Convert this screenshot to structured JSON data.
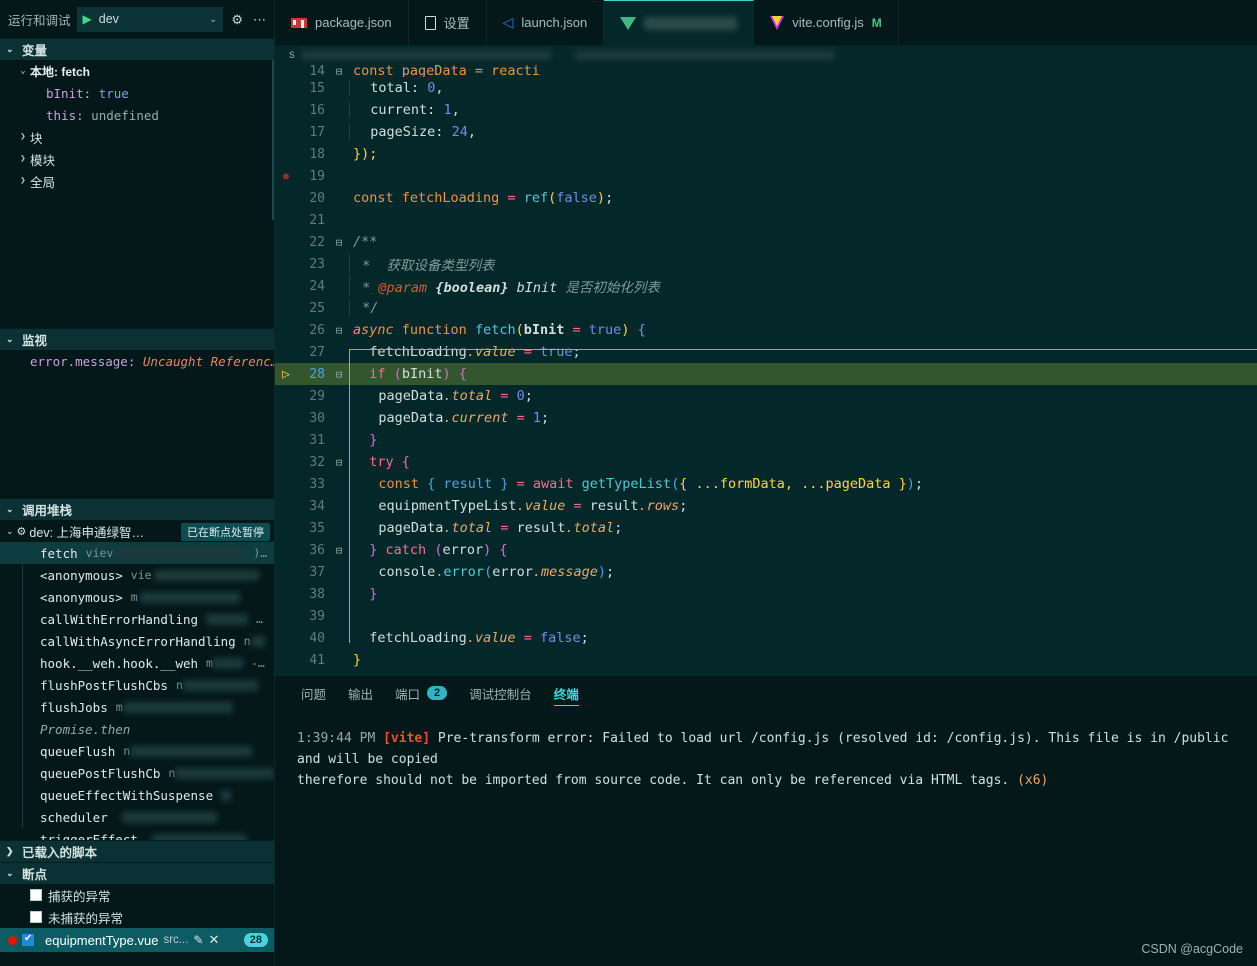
{
  "sidebar": {
    "toolbar": {
      "label": "运行和调试",
      "config": "dev",
      "gear_icon": "gear-icon",
      "more_icon": "more-icon",
      "play_icon": "play-icon"
    },
    "variables": {
      "title": "变量",
      "scopes": [
        {
          "label": "本地: fetch",
          "expanded": true,
          "entries": [
            {
              "name": "bInit:",
              "value": "true",
              "kind": "bool"
            },
            {
              "name": "this:",
              "value": "undefined",
              "kind": "undef"
            }
          ]
        },
        {
          "label": "块",
          "expanded": false,
          "entries": []
        },
        {
          "label": "模块",
          "expanded": false,
          "entries": []
        },
        {
          "label": "全局",
          "expanded": false,
          "entries": []
        }
      ]
    },
    "watch": {
      "title": "监视",
      "items": [
        {
          "expression": "error.message:",
          "value": "Uncaught Referenc…"
        }
      ]
    },
    "callstack": {
      "title": "调用堆栈",
      "session": "dev: 上海申通绿智…",
      "paused_badge": "已在断点处暂停",
      "frames": [
        {
          "name": "fetch",
          "path": "viev",
          "selected": true
        },
        {
          "name": "<anonymous>",
          "path": "vie",
          "selected": false
        },
        {
          "name": "<anonymous>",
          "path": "m",
          "selected": false
        },
        {
          "name": "callWithErrorHandling",
          "path": "",
          "selected": false
        },
        {
          "name": "callWithAsyncErrorHandling",
          "path": "n",
          "selected": false
        },
        {
          "name": "hook.__weh.hook.__weh",
          "path": "m",
          "selected": false
        },
        {
          "name": "flushPostFlushCbs",
          "path": "n",
          "selected": false
        },
        {
          "name": "flushJobs",
          "path": "m",
          "selected": false
        },
        {
          "name": "Promise.then",
          "path": "",
          "selected": false,
          "async": true
        },
        {
          "name": "queueFlush",
          "path": "n",
          "selected": false
        },
        {
          "name": "queuePostFlushCb",
          "path": "n",
          "selected": false
        },
        {
          "name": "queueEffectWithSuspense",
          "path": "",
          "selected": false
        },
        {
          "name": "scheduler",
          "path": "",
          "selected": false
        },
        {
          "name": "triggerEffect",
          "path": "",
          "selected": false
        }
      ]
    },
    "loaded_scripts": {
      "title": "已载入的脚本",
      "expanded": false
    },
    "breakpoints": {
      "title": "断点",
      "exception_options": [
        {
          "label": "捕获的异常",
          "checked": false
        },
        {
          "label": "未捕获的异常",
          "checked": false
        }
      ],
      "files": [
        {
          "name": "equipmentType.vue",
          "src": "src...",
          "checked": true,
          "line": "28",
          "edit_icon": "pencil-icon",
          "close_icon": "close-icon",
          "dot_icon": "breakpoint-dot-icon"
        }
      ]
    }
  },
  "tabs": [
    {
      "label": "package.json",
      "icon": "npm-icon",
      "active": false,
      "modified": ""
    },
    {
      "label": "设置",
      "icon": "file-icon",
      "active": false,
      "modified": ""
    },
    {
      "label": "launch.json",
      "icon": "vscode-icon",
      "active": false,
      "modified": ""
    },
    {
      "label": "",
      "icon": "vue-icon",
      "active": true,
      "modified": "",
      "blurred": true
    },
    {
      "label": "vite.config.js",
      "icon": "vite-icon",
      "active": false,
      "modified": "M"
    }
  ],
  "editor": {
    "lines": [
      {
        "num": "14",
        "partial": true
      },
      {
        "num": "15"
      },
      {
        "num": "16"
      },
      {
        "num": "17"
      },
      {
        "num": "18"
      },
      {
        "num": "19",
        "breakpoint": true
      },
      {
        "num": "20"
      },
      {
        "num": "21"
      },
      {
        "num": "22",
        "fold": true
      },
      {
        "num": "23"
      },
      {
        "num": "24"
      },
      {
        "num": "25"
      },
      {
        "num": "26",
        "fold": true
      },
      {
        "num": "27"
      },
      {
        "num": "28",
        "fold": true,
        "current": true,
        "breakpoint": true
      },
      {
        "num": "29"
      },
      {
        "num": "30"
      },
      {
        "num": "31"
      },
      {
        "num": "32",
        "fold": true
      },
      {
        "num": "33"
      },
      {
        "num": "34"
      },
      {
        "num": "35"
      },
      {
        "num": "36",
        "fold": true
      },
      {
        "num": "37"
      },
      {
        "num": "38"
      },
      {
        "num": "39"
      },
      {
        "num": "40"
      },
      {
        "num": "41"
      }
    ],
    "text": {
      "l14": "const pageData = reacti",
      "l15_key": "total:",
      "l15_val": "0",
      "l16_key": "current:",
      "l16_val": "1",
      "l17_key": "pageSize:",
      "l17_val": "24",
      "l18": "});",
      "l20_kw": "const",
      "l20_name": "fetchLoading",
      "l20_eq": "=",
      "l20_fn": "ref",
      "l20_arg": "false",
      "l22": "/**",
      "l23": "*  获取设备类型列表",
      "l24_star": "*",
      "l24_tag": "@param",
      "l24_type": "{boolean}",
      "l24_param": "bInit",
      "l24_desc": "是否初始化列表",
      "l25": "*/",
      "l26_async": "async",
      "l26_fnkw": "function",
      "l26_name": "fetch",
      "l26_param": "bInit",
      "l26_default": "true",
      "l27_obj": "fetchLoading",
      "l27_prop": ".value",
      "l27_val": "true",
      "l28_kw": "if",
      "l28_cond": "bInit",
      "l29_obj": "pageData",
      "l29_prop": ".total",
      "l29_val": "0",
      "l30_obj": "pageData",
      "l30_prop": ".current",
      "l30_val": "1",
      "l31": "}",
      "l32": "try {",
      "l33_kw": "const",
      "l33_destr": "{ result }",
      "l33_await": "await",
      "l33_fn": "getTypeList",
      "l33_args": "{ ...formData, ...pageData }",
      "l34_obj": "equipmentTypeList",
      "l34_prop": ".value",
      "l34_rhs": "result",
      "l34_rprop": ".rows",
      "l35_obj": "pageData",
      "l35_prop": ".total",
      "l35_rhs": "result",
      "l35_rprop": ".total",
      "l36_kw": "catch",
      "l36_arg": "error",
      "l37_obj": "console",
      "l37_fn": ".error",
      "l37_arg": "error",
      "l37_prop": ".message",
      "l38": "}",
      "l40_obj": "fetchLoading",
      "l40_prop": ".value",
      "l40_val": "false",
      "l41": "}"
    }
  },
  "panel": {
    "tabs": [
      {
        "label": "问题",
        "active": false,
        "badge": ""
      },
      {
        "label": "输出",
        "active": false,
        "badge": ""
      },
      {
        "label": "端口",
        "active": false,
        "badge": "2"
      },
      {
        "label": "调试控制台",
        "active": false,
        "badge": ""
      },
      {
        "label": "终端",
        "active": true,
        "badge": ""
      }
    ],
    "terminal": {
      "time": "1:39:44 PM",
      "tag": "[vite]",
      "line1": " Pre-transform error: Failed to load url /config.js (resolved id: /config.js). This file is in /public and will be copied",
      "line2": "therefore should not be imported from source code. It can only be referenced via HTML tags. ",
      "repeat": "(x6)"
    }
  },
  "watermark": "CSDN @acgCode",
  "colors": {
    "accent": "#3fd9d9",
    "sidebar_bg": "#04181a",
    "editor_bg": "#04282a",
    "current_line": "#33562f",
    "breakpoint": "#e51400",
    "modified": "#4ec47a"
  }
}
